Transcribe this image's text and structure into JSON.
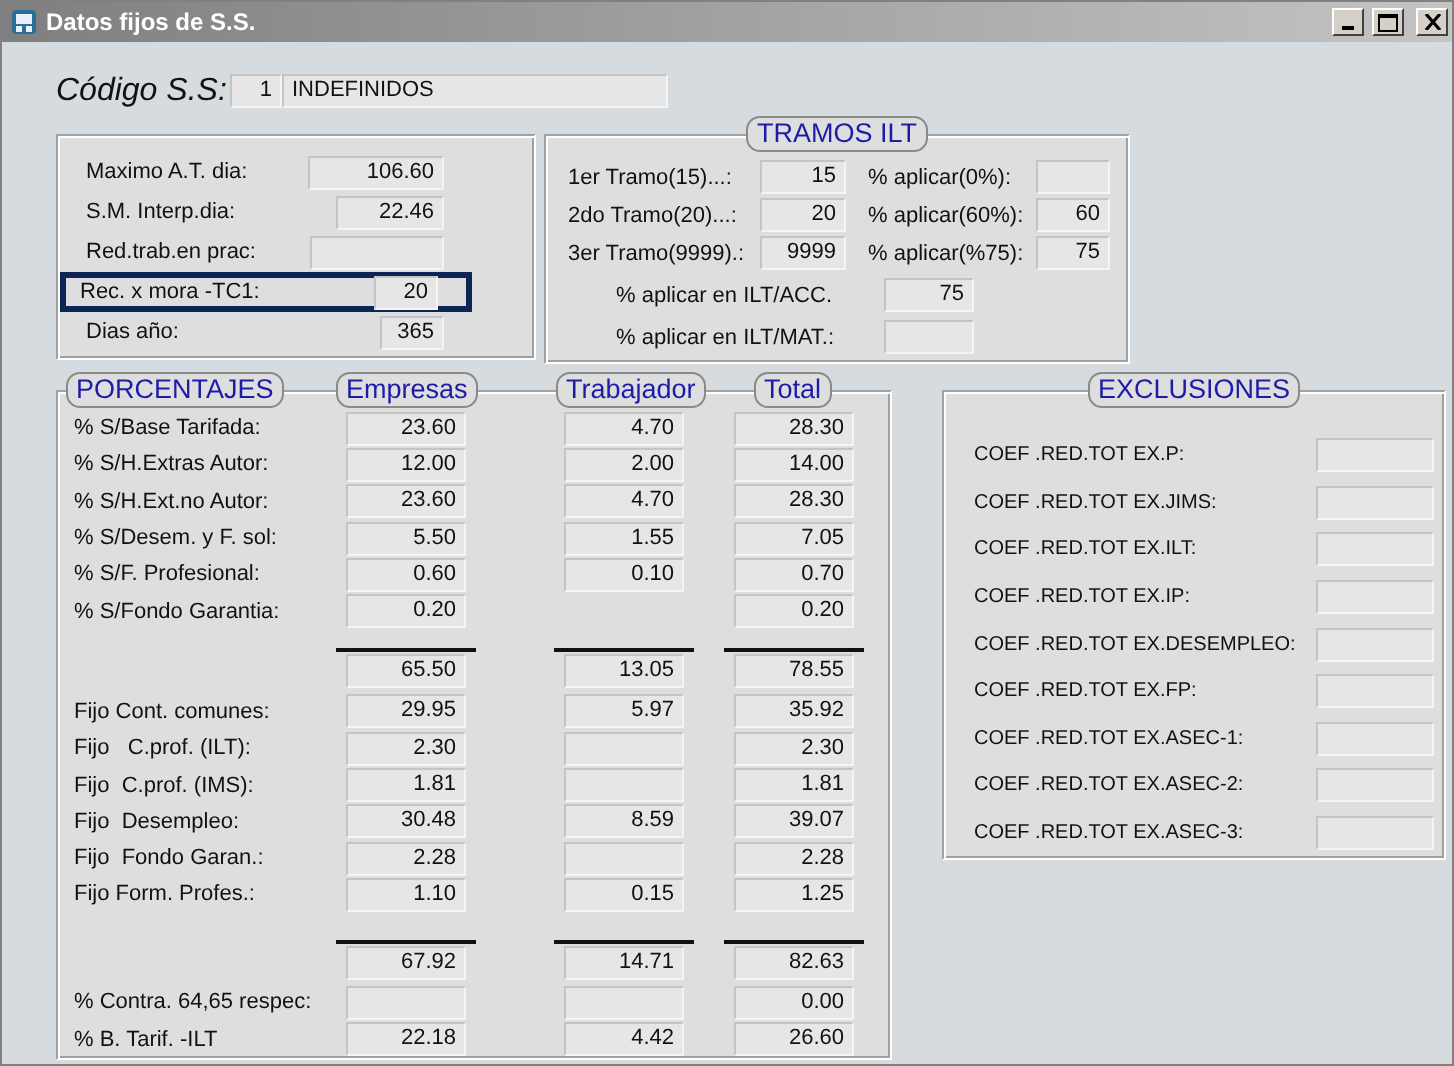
{
  "window": {
    "title": "Datos fijos de S.S."
  },
  "codigo": {
    "label": "Código S.S:",
    "number": "1",
    "name": "INDEFINIDOS"
  },
  "general": {
    "rows": [
      {
        "label": "Maximo A.T. dia:",
        "value": "106.60",
        "highlighted": false
      },
      {
        "label": "S.M. Interp.dia:",
        "value": "22.46",
        "highlighted": false
      },
      {
        "label": "Red.trab.en prac:",
        "highlighted": false
      },
      {
        "label": "Rec. x mora -TC1:",
        "value": "20",
        "highlighted": true
      },
      {
        "label": "Dias año:",
        "value": "365",
        "highlighted": false
      }
    ]
  },
  "tramos": {
    "title": "TRAMOS ILT",
    "rows": [
      {
        "label": "1er Tramo(15)...:",
        "value": "15",
        "pct_label": "% aplicar(0%):"
      },
      {
        "label": "2do Tramo(20)...:",
        "value": "20",
        "pct_label": "% aplicar(60%):",
        "pct_value": "60"
      },
      {
        "label": "3er Tramo(9999).:",
        "value": "9999",
        "pct_label": "% aplicar(%75):",
        "pct_value": "75"
      }
    ],
    "extra": [
      {
        "label": "% aplicar en ILT/ACC.",
        "value": "75"
      },
      {
        "label": "% aplicar en ILT/MAT.:"
      }
    ]
  },
  "porcentajes": {
    "title": "PORCENTAJES",
    "columns": [
      "Empresas",
      "Trabajador",
      "Total"
    ],
    "rows": [
      {
        "kind": "row",
        "label": "% S/Base Tarifada:",
        "cells": [
          {
            "kind": "field",
            "value": "23.60"
          },
          {
            "kind": "field",
            "value": "4.70"
          },
          {
            "kind": "field",
            "value": "28.30"
          }
        ]
      },
      {
        "kind": "row",
        "label": "% S/H.Extras Autor:",
        "cells": [
          {
            "kind": "field",
            "value": "12.00"
          },
          {
            "kind": "field",
            "value": "2.00"
          },
          {
            "kind": "field",
            "value": "14.00"
          }
        ]
      },
      {
        "kind": "row",
        "label": "% S/H.Ext.no Autor:",
        "cells": [
          {
            "kind": "field",
            "value": "23.60"
          },
          {
            "kind": "field",
            "value": "4.70"
          },
          {
            "kind": "field",
            "value": "28.30"
          }
        ]
      },
      {
        "kind": "row",
        "label": "% S/Desem. y F. sol:",
        "cells": [
          {
            "kind": "field",
            "value": "5.50"
          },
          {
            "kind": "field",
            "value": "1.55"
          },
          {
            "kind": "field",
            "value": "7.05"
          }
        ]
      },
      {
        "kind": "row",
        "label": "% S/F. Profesional:",
        "cells": [
          {
            "kind": "field",
            "value": "0.60"
          },
          {
            "kind": "field",
            "value": "0.10"
          },
          {
            "kind": "field",
            "value": "0.70"
          }
        ]
      },
      {
        "kind": "row",
        "label": "% S/Fondo Garantia:",
        "cells": [
          {
            "kind": "field",
            "value": "0.20"
          },
          {
            "kind": "none"
          },
          {
            "kind": "field",
            "value": "0.20"
          }
        ]
      },
      {
        "kind": "total",
        "cells": [
          {
            "kind": "field",
            "value": "65.50"
          },
          {
            "kind": "field",
            "value": "13.05"
          },
          {
            "kind": "field",
            "value": "78.55"
          }
        ]
      },
      {
        "kind": "row",
        "label": "Fijo Cont. comunes:",
        "cells": [
          {
            "kind": "field",
            "value": "29.95"
          },
          {
            "kind": "field",
            "value": "5.97"
          },
          {
            "kind": "field",
            "value": "35.92"
          }
        ]
      },
      {
        "kind": "row",
        "label": "Fijo   C.prof. (ILT):",
        "cells": [
          {
            "kind": "field",
            "value": "2.30"
          },
          {
            "kind": "field"
          },
          {
            "kind": "field",
            "value": "2.30"
          }
        ]
      },
      {
        "kind": "row",
        "label": "Fijo  C.prof. (IMS):",
        "cells": [
          {
            "kind": "field",
            "value": "1.81"
          },
          {
            "kind": "field"
          },
          {
            "kind": "field",
            "value": "1.81"
          }
        ]
      },
      {
        "kind": "row",
        "label": "Fijo  Desempleo:",
        "cells": [
          {
            "kind": "field",
            "value": "30.48"
          },
          {
            "kind": "field",
            "value": "8.59"
          },
          {
            "kind": "field",
            "value": "39.07"
          }
        ]
      },
      {
        "kind": "row",
        "label": "Fijo  Fondo Garan.:",
        "cells": [
          {
            "kind": "field",
            "value": "2.28"
          },
          {
            "kind": "field"
          },
          {
            "kind": "field",
            "value": "2.28"
          }
        ]
      },
      {
        "kind": "row",
        "label": "Fijo Form. Profes.:",
        "cells": [
          {
            "kind": "field",
            "value": "1.10"
          },
          {
            "kind": "field",
            "value": "0.15"
          },
          {
            "kind": "field",
            "value": "1.25"
          }
        ]
      },
      {
        "kind": "total",
        "cells": [
          {
            "kind": "field",
            "value": "67.92"
          },
          {
            "kind": "field",
            "value": "14.71"
          },
          {
            "kind": "field",
            "value": "82.63"
          }
        ]
      },
      {
        "kind": "row",
        "label": "% Contra. 64,65 respec:",
        "cells": [
          {
            "kind": "field"
          },
          {
            "kind": "field"
          },
          {
            "kind": "field",
            "value": "0.00"
          }
        ]
      },
      {
        "kind": "row",
        "label": "% B. Tarif. -ILT",
        "cells": [
          {
            "kind": "field",
            "value": "22.18"
          },
          {
            "kind": "field",
            "value": "4.42"
          },
          {
            "kind": "field",
            "value": "26.60"
          }
        ]
      }
    ]
  },
  "exclusiones": {
    "title": "EXCLUSIONES",
    "rows": [
      {
        "label": "COEF .RED.TOT EX.P:"
      },
      {
        "label": "COEF .RED.TOT EX.JIMS:"
      },
      {
        "label": "COEF .RED.TOT EX.ILT:"
      },
      {
        "label": "COEF .RED.TOT EX.IP:"
      },
      {
        "label": "COEF .RED.TOT EX.DESEMPLEO:"
      },
      {
        "label": "COEF .RED.TOT EX.FP:"
      },
      {
        "label": "COEF .RED.TOT EX.ASEC-1:"
      },
      {
        "label": "COEF .RED.TOT EX.ASEC-2:"
      },
      {
        "label": "COEF .RED.TOT EX.ASEC-3:"
      }
    ]
  }
}
